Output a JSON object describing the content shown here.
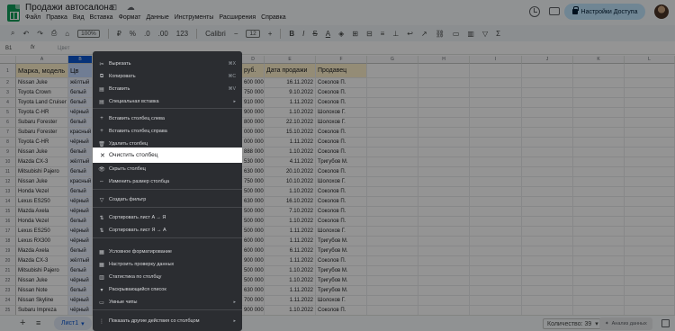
{
  "app": {
    "doc_title": "Продажи автосалона",
    "menu": [
      "Файл",
      "Правка",
      "Вид",
      "Вставка",
      "Формат",
      "Данные",
      "Инструменты",
      "Расширения",
      "Справка"
    ],
    "share_label": "Настройки Доступа"
  },
  "toolbar": {
    "zoom": "100%",
    "font": "Calibri",
    "font_size": "12"
  },
  "formula": {
    "cell_ref": "B1",
    "value": "Цвет"
  },
  "columns": [
    "A",
    "B",
    "C",
    "D",
    "E",
    "F",
    "G",
    "H",
    "I",
    "J",
    "K",
    "L",
    "M"
  ],
  "headers": {
    "a": "Марка, модель",
    "b": "Цв",
    "d": "руб.",
    "e": "Дата продажи",
    "f": "Продавец"
  },
  "rows": [
    {
      "n": "2",
      "a": "Nissan Juke",
      "b": "жёлтый",
      "d": "600 000",
      "e": "16.11.2022",
      "f": "Соколов П."
    },
    {
      "n": "3",
      "a": "Toyota Crown",
      "b": "белый",
      "d": "750 000",
      "e": "9.10.2022",
      "f": "Соколов П."
    },
    {
      "n": "4",
      "a": "Toyota Land Cruiser",
      "b": "белый",
      "d": "910 000",
      "e": "1.11.2022",
      "f": "Соколов П."
    },
    {
      "n": "5",
      "a": "Toyota C-HR",
      "b": "чёрный",
      "d": "900 000",
      "e": "1.10.2022",
      "f": "Шолохов Г."
    },
    {
      "n": "6",
      "a": "Subaru Forester",
      "b": "белый",
      "d": "800 000",
      "e": "22.10.2022",
      "f": "Шолохов Г."
    },
    {
      "n": "7",
      "a": "Subaru Forester",
      "b": "красный",
      "d": "000 000",
      "e": "15.10.2022",
      "f": "Соколов П."
    },
    {
      "n": "8",
      "a": "Toyota C-HR",
      "b": "чёрный",
      "d": "000 000",
      "e": "1.11.2022",
      "f": "Соколов П."
    },
    {
      "n": "9",
      "a": "Nissan Juke",
      "b": "белый",
      "d": "888 000",
      "e": "1.10.2022",
      "f": "Соколов П."
    },
    {
      "n": "10",
      "a": "Mazda CX-3",
      "b": "жёлтый",
      "d": "530 000",
      "e": "4.11.2022",
      "f": "Тригубов М."
    },
    {
      "n": "11",
      "a": "Mitsubishi Pajero",
      "b": "белый",
      "d": "630 000",
      "e": "20.10.2022",
      "f": "Соколов П."
    },
    {
      "n": "12",
      "a": "Nissan Juke",
      "b": "красный",
      "d": "750 000",
      "e": "10.10.2022",
      "f": "Шолохов Г."
    },
    {
      "n": "13",
      "a": "Honda Vezel",
      "b": "белый",
      "d": "500 000",
      "e": "1.10.2022",
      "f": "Соколов П."
    },
    {
      "n": "14",
      "a": "Lexus ES250",
      "b": "чёрный",
      "d": "630 000",
      "e": "16.10.2022",
      "f": "Соколов П."
    },
    {
      "n": "15",
      "a": "Mazda Axela",
      "b": "чёрный",
      "d": "500 000",
      "e": "7.10.2022",
      "f": "Соколов П."
    },
    {
      "n": "16",
      "a": "Honda Vezel",
      "b": "белый",
      "d": "500 000",
      "e": "1.10.2022",
      "f": "Соколов П."
    },
    {
      "n": "17",
      "a": "Lexus ES250",
      "b": "чёрный",
      "d": "500 000",
      "e": "1.11.2022",
      "f": "Шолохов Г."
    },
    {
      "n": "18",
      "a": "Lexus RX300",
      "b": "чёрный",
      "d": "600 000",
      "e": "1.11.2022",
      "f": "Тригубов М."
    },
    {
      "n": "19",
      "a": "Mazda Axela",
      "b": "белый",
      "d": "600 000",
      "e": "6.11.2022",
      "f": "Тригубов М."
    },
    {
      "n": "20",
      "a": "Mazda CX-3",
      "b": "жёлтый",
      "d": "900 000",
      "e": "1.11.2022",
      "f": "Соколов П."
    },
    {
      "n": "21",
      "a": "Mitsubishi Pajero",
      "b": "белый",
      "d": "500 000",
      "e": "1.10.2022",
      "f": "Тригубов М."
    },
    {
      "n": "22",
      "a": "Nissan Juke",
      "b": "чёрный",
      "d": "500 000",
      "e": "1.10.2022",
      "f": "Тригубов М."
    },
    {
      "n": "23",
      "a": "Nissan Note",
      "b": "белый",
      "d": "630 000",
      "e": "1.11.2022",
      "f": "Тригубов М."
    },
    {
      "n": "24",
      "a": "Nissan Skyline",
      "b": "чёрный",
      "d": "700 000",
      "e": "1.11.2022",
      "f": "Шолохов Г."
    },
    {
      "n": "25",
      "a": "Subaru Impreza",
      "b": "чёрный",
      "d": "900 000",
      "e": "1.10.2022",
      "f": "Соколов П."
    }
  ],
  "context_menu": {
    "items": [
      {
        "icon": "✂",
        "label": "Вырезать",
        "shortcut": "⌘X"
      },
      {
        "icon": "⧉",
        "label": "Копировать",
        "shortcut": "⌘C"
      },
      {
        "icon": "▤",
        "label": "Вставить",
        "shortcut": "⌘V"
      },
      {
        "icon": "▤",
        "label": "Специальная вставка",
        "shortcut": "▸"
      },
      {
        "icon": "+",
        "label": "Вставить столбец слева",
        "shortcut": ""
      },
      {
        "icon": "+",
        "label": "Вставить столбец справа",
        "shortcut": ""
      },
      {
        "icon": "🗑",
        "label": "Удалить столбец",
        "shortcut": ""
      },
      {
        "icon": "👁",
        "label": "Скрыть столбец",
        "shortcut": ""
      },
      {
        "icon": "⇔",
        "label": "Изменить размер столбца",
        "shortcut": ""
      },
      {
        "icon": "▽",
        "label": "Создать фильтр",
        "shortcut": ""
      },
      {
        "icon": "⇅",
        "label": "Сортировать лист A → Я",
        "shortcut": ""
      },
      {
        "icon": "⇅",
        "label": "Сортировать лист Я → A",
        "shortcut": ""
      },
      {
        "icon": "▦",
        "label": "Условное форматирование",
        "shortcut": ""
      },
      {
        "icon": "▦",
        "label": "Настроить проверку данных",
        "shortcut": ""
      },
      {
        "icon": "▥",
        "label": "Статистика по столбцу",
        "shortcut": ""
      },
      {
        "icon": "▾",
        "label": "Раскрывающийся список",
        "shortcut": ""
      },
      {
        "icon": "▭",
        "label": "Умные чипы",
        "shortcut": "▸"
      },
      {
        "icon": "⋮",
        "label": "Показать другие действия со столбцом",
        "shortcut": "▸"
      }
    ],
    "highlighted": {
      "icon": "✕",
      "label": "Очистить столбец"
    }
  },
  "bottom": {
    "sheet_name": "Лист1",
    "count_label": "Количество: 39",
    "explore_label": "Анализ данных"
  }
}
